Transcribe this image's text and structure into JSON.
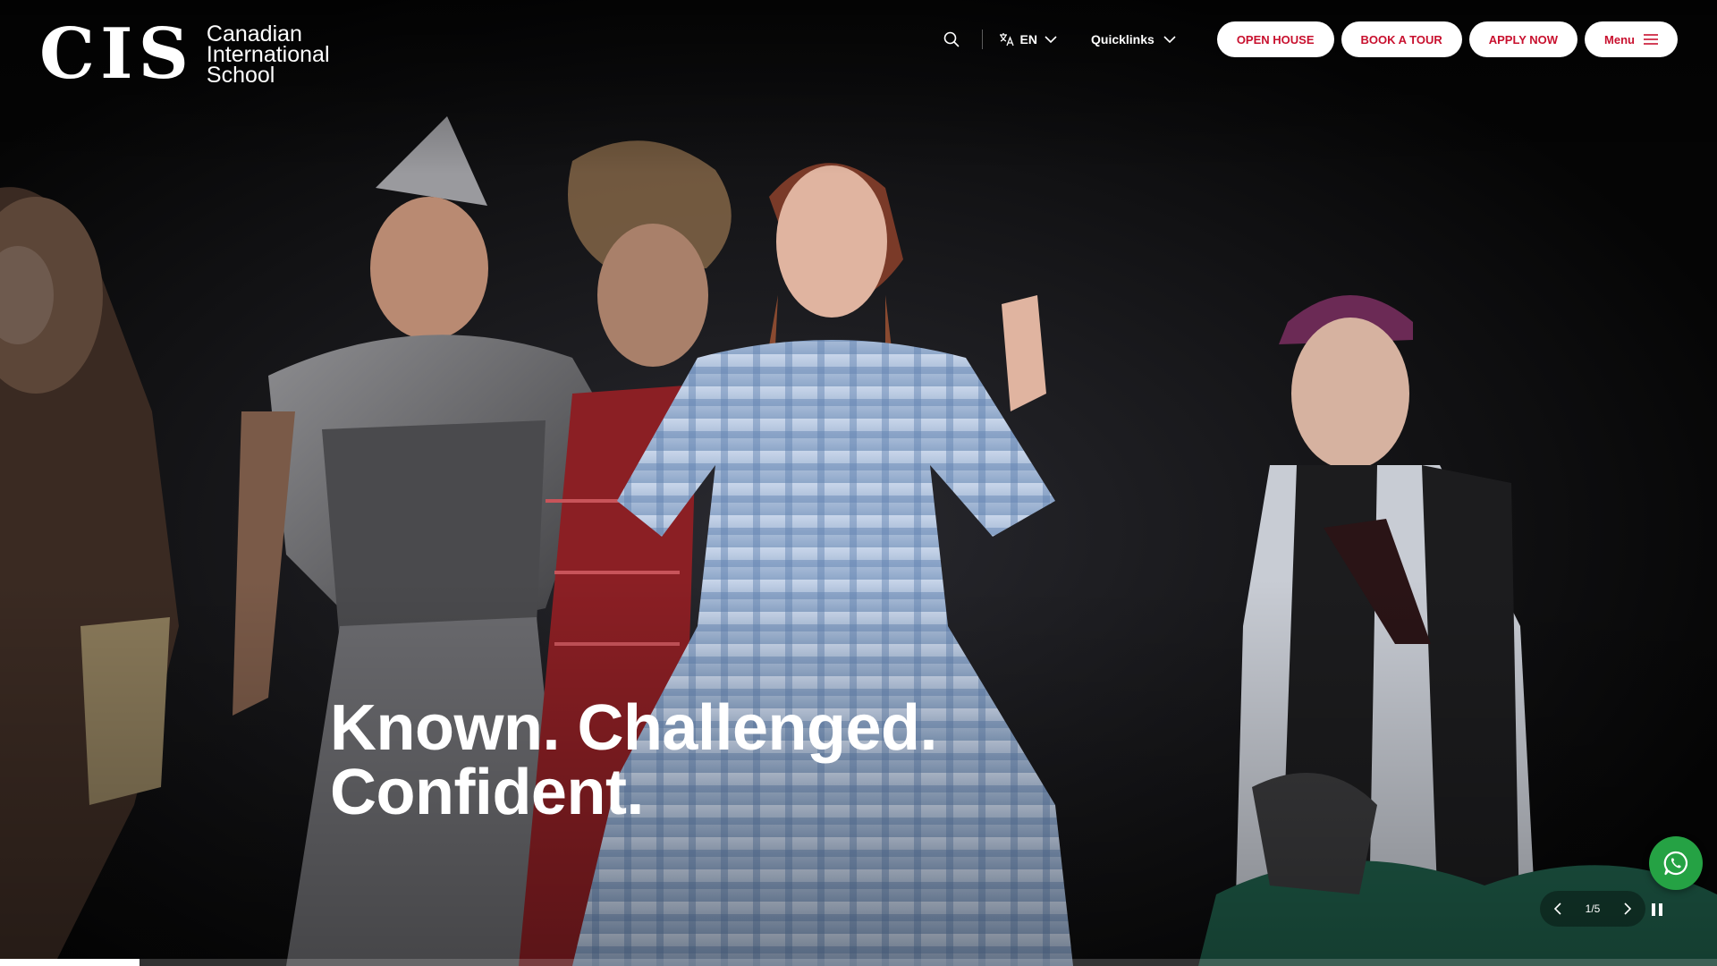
{
  "brand": {
    "mark": "CIS",
    "name_lines": [
      "Canadian",
      "International",
      "School"
    ]
  },
  "nav": {
    "search_icon": "search-icon",
    "language": "EN",
    "quicklinks": "Quicklinks",
    "buttons": [
      "OPEN HOUSE",
      "BOOK A TOUR",
      "APPLY NOW"
    ],
    "menu": "Menu",
    "button_text_color": "#c8102e"
  },
  "hero": {
    "headline_line1": "Known. Challenged.",
    "headline_line2": "Confident.",
    "slide_counter": "1/5",
    "progress_fraction": 0.081
  },
  "whatsapp": {
    "icon": "whatsapp-icon",
    "color": "#25a244"
  }
}
